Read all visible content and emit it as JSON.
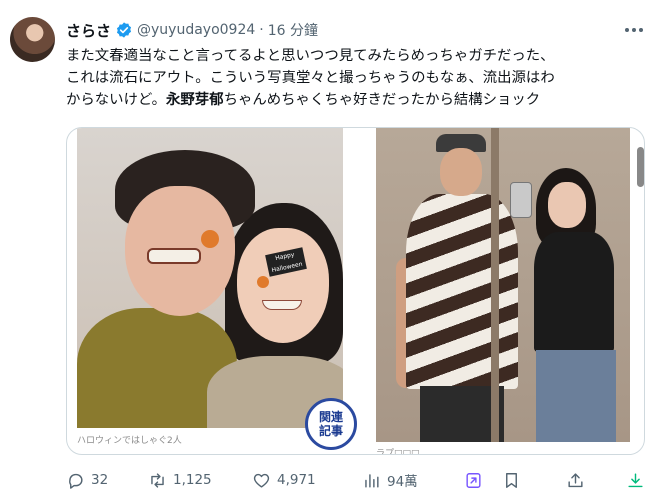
{
  "tweet": {
    "author_name": "さらさ",
    "handle": "@yuyudayo0924",
    "separator": "·",
    "time": "16 分鐘",
    "text_lines": [
      "また文春適当なこと言ってるよと思いつつ見てみたらめっちゃガチだった、",
      "これは流石にアウト。こういう写真堂々と撮っちゃうのもなぁ、流出源はわ",
      "からないけど。"
    ],
    "mention": "永野芽郁",
    "text_tail": "ちゃんめちゃくちゃ好きだったから結構ショック"
  },
  "media": {
    "left_caption": "ハロウィンではしゃぐ2人",
    "badge_line1": "関連",
    "badge_line2": "記事",
    "sticker_text": "Happy Halloween",
    "right_caption": "ラプ□□□"
  },
  "actions": {
    "reply_count": "32",
    "retweet_count": "1,125",
    "like_count": "4,971",
    "view_count": "94萬"
  },
  "colors": {
    "verified": "#1d9bf0",
    "grok": "#7856ff",
    "download": "#00ba7c",
    "text": "#0f1419",
    "secondary": "#536471"
  },
  "icons": {
    "verified": "verified-badge-icon",
    "more": "more-icon",
    "reply": "reply-icon",
    "retweet": "retweet-icon",
    "like": "heart-icon",
    "views": "views-icon",
    "grok": "grok-icon",
    "bookmark": "bookmark-icon",
    "share": "share-icon",
    "download": "download-icon"
  }
}
